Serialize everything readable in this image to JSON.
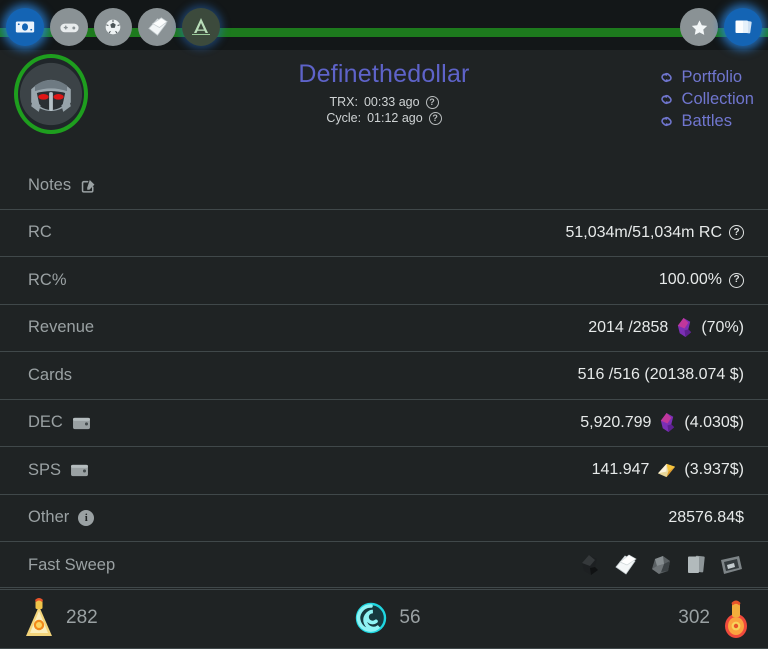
{
  "nav": {
    "left_items": [
      {
        "name": "money-icon",
        "label": "Money",
        "active": true
      },
      {
        "name": "gamepad-icon",
        "label": "Games",
        "active": false
      },
      {
        "name": "soccer-ball-icon",
        "label": "Sports",
        "active": false
      },
      {
        "name": "cards-icon",
        "label": "Cards",
        "active": false
      },
      {
        "name": "alpha-logo-icon",
        "label": "Alpha",
        "active": false
      }
    ],
    "right_items": [
      {
        "name": "star-icon",
        "label": "Favorites",
        "active": false
      },
      {
        "name": "card-stack-icon",
        "label": "Collection",
        "active": true
      }
    ]
  },
  "header": {
    "username": "Definethedollar",
    "avatar_alt": "robot-avatar",
    "trx_label": "TRX:",
    "trx_value": "00:33 ago",
    "cycle_label": "Cycle:",
    "cycle_value": "01:12 ago",
    "help_glyph": "?",
    "links": [
      {
        "icon": "link-icon",
        "label": "Portfolio"
      },
      {
        "icon": "link-icon",
        "label": "Collection"
      },
      {
        "icon": "link-icon",
        "label": "Battles"
      }
    ]
  },
  "rows": [
    {
      "key": "notes",
      "label": "Notes",
      "label_icon": "edit-icon",
      "value": "",
      "value_icon": "",
      "help": false
    },
    {
      "key": "rc",
      "label": "RC",
      "label_icon": "",
      "value": "51,034m/51,034m RC",
      "value_icon": "",
      "help": true
    },
    {
      "key": "rcpct",
      "label": "RC%",
      "label_icon": "",
      "value": "100.00%",
      "value_icon": "",
      "help": true
    },
    {
      "key": "revenue",
      "label": "Revenue",
      "label_icon": "",
      "value": "2014 /2858",
      "value_icon": "dec-gem-icon",
      "suffix": "(70%)",
      "help": false
    },
    {
      "key": "cards",
      "label": "Cards",
      "label_icon": "",
      "value": "516 /516 (20138.074 $)",
      "value_icon": "",
      "help": false
    },
    {
      "key": "dec",
      "label": "DEC",
      "label_icon": "wallet-icon",
      "value": "5,920.799",
      "value_icon": "dec-gem-icon",
      "suffix": "(4.030$)",
      "help": false
    },
    {
      "key": "sps",
      "label": "SPS",
      "label_icon": "wallet-icon",
      "value": "141.947",
      "value_icon": "sps-icon",
      "suffix": "(3.937$)",
      "help": false
    },
    {
      "key": "other",
      "label": "Other",
      "label_icon": "info-icon",
      "value": "28576.84$",
      "value_icon": "",
      "help": false
    },
    {
      "key": "fastsweep",
      "label": "Fast Sweep",
      "label_icon": "",
      "value": "",
      "value_icon": "",
      "help": false
    }
  ],
  "fast_sweep_icons": [
    {
      "name": "dark-gem-icon"
    },
    {
      "name": "white-paper-icon"
    },
    {
      "name": "rock-chunk-icon"
    },
    {
      "name": "card-stack-gray-icon"
    },
    {
      "name": "framed-item-icon"
    }
  ],
  "bottom": [
    {
      "icon": "gold-potion-icon",
      "value": "282",
      "icon_first": true
    },
    {
      "icon": "teal-spiral-icon",
      "value": "56",
      "icon_first": true
    },
    {
      "icon": "red-potion-icon",
      "value": "302",
      "icon_first": false
    }
  ],
  "colors": {
    "background": "#1f2324",
    "topbar": "#131718",
    "accent_green": "#1d7a1d",
    "title_purple": "#5e63c9",
    "link_purple": "#7076cf",
    "label_gray": "#9aa1a3",
    "value_white": "#e7eaea",
    "divider": "#40484a",
    "active_blue": "#1464b4"
  }
}
